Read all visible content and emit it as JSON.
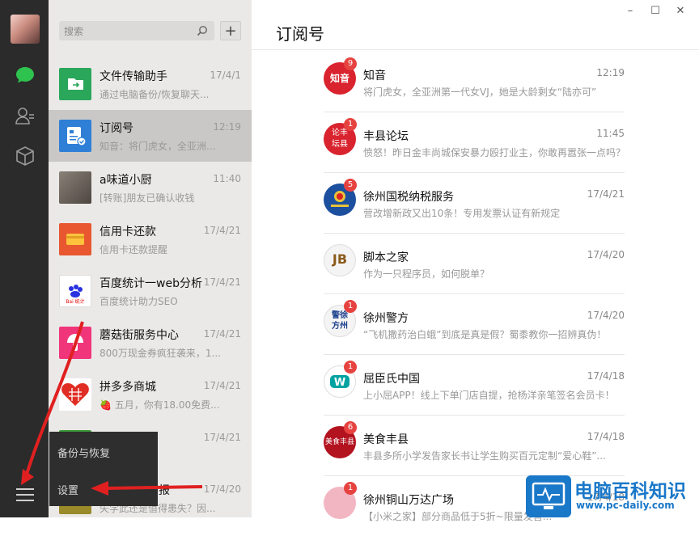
{
  "search": {
    "placeholder": "搜索"
  },
  "add_button": "+",
  "chats": [
    {
      "title": "文件传输助手",
      "time": "17/4/1",
      "preview": "通过电脑备份/恢复聊天...",
      "color": "#2aa75a",
      "icon": "file-transfer-icon"
    },
    {
      "title": "订阅号",
      "time": "12:19",
      "preview": "知音：将门虎女，全亚洲...",
      "color": "#2f7fd6",
      "icon": "subscription-icon"
    },
    {
      "title": "a味道小厨",
      "time": "11:40",
      "preview": "[转账]朋友已确认收钱",
      "color": "#6b625a",
      "icon": "chef-avatar"
    },
    {
      "title": "信用卡还款",
      "time": "17/4/21",
      "preview": "信用卡还款提醒",
      "color": "#e8572f",
      "icon": "credit-card-icon"
    },
    {
      "title": "百度统计一web分析",
      "time": "17/4/21",
      "preview": "百度统计助力SEO",
      "color": "#ffffff",
      "icon": "baidu-stats-logo"
    },
    {
      "title": "蘑菇街服务中心",
      "time": "17/4/21",
      "preview": "800万现金券疯狂袭来，1...",
      "color": "#f0357b",
      "icon": "mogujie-logo"
    },
    {
      "title": "拼多多商城",
      "time": "17/4/21",
      "preview": "🍓 五月，你有18.00免费...",
      "color": "#e02e24",
      "icon": "pinduoduo-logo"
    },
    {
      "title": "",
      "time": "17/4/21",
      "preview": "",
      "color": "#3a9a3a",
      "icon": "account-avatar"
    },
    {
      "title": "报",
      "time": "17/4/20",
      "preview": "失学此还是值得患失？因...",
      "color": "#9a8a2a",
      "icon": "account-avatar"
    }
  ],
  "popup_menu": {
    "backup": "备份与恢复",
    "settings": "设置"
  },
  "main": {
    "title": "订阅号"
  },
  "window_controls": {
    "minimize": "–",
    "maximize": "☐",
    "close": "✕"
  },
  "articles": [
    {
      "name": "知音",
      "time": "12:19",
      "badge": "9",
      "preview": "将门虎女，全亚洲第一代女VJ，她是大龄剩女“陆亦可”",
      "color": "#d9232e",
      "logo": "知音"
    },
    {
      "name": "丰县论坛",
      "time": "11:45",
      "badge": "1",
      "preview": "愤怒！昨日金丰尚城保安暴力殴打业主，你敢再嚣张一点吗？",
      "color": "#d9232e",
      "logo": "论丰坛县"
    },
    {
      "name": "徐州国税纳税服务",
      "time": "17/4/21",
      "badge": "5",
      "preview": "营改增新政又出10条！专用发票认证有新规定",
      "color": "#1c4f9e",
      "logo": "国税"
    },
    {
      "name": "脚本之家",
      "time": "17/4/20",
      "badge": "",
      "preview": "作为一只程序员，如何脱单？",
      "color": "#f4f4f4",
      "logo": "JB"
    },
    {
      "name": "徐州警方",
      "time": "17/4/20",
      "badge": "1",
      "preview": "“飞机撒药治白蛾”到底是真是假？蜀黍教你一招辨真伪！",
      "color": "#f4f4f4",
      "logo": "警徐方州"
    },
    {
      "name": "屈臣氏中国",
      "time": "17/4/18",
      "badge": "1",
      "preview": "上小屈APP！线上下单门店自提，抢杨洋亲笔签名会员卡！",
      "color": "#00a3a0",
      "logo": "W"
    },
    {
      "name": "美食丰县",
      "time": "17/4/18",
      "badge": "6",
      "preview": "丰县多所小学发告家长书让学生购买百元定制“爱心鞋”...",
      "color": "#b3121f",
      "logo": "美食丰县"
    },
    {
      "name": "徐州铜山万达广场",
      "time": "17/4/18",
      "badge": "1",
      "preview": "【小米之家】部分商品低于5折~限量发售...",
      "color": "#f2b6c2",
      "logo": "万达"
    }
  ],
  "watermark": {
    "title": "电脑百科知识",
    "url": "www.pc-daily.com"
  }
}
